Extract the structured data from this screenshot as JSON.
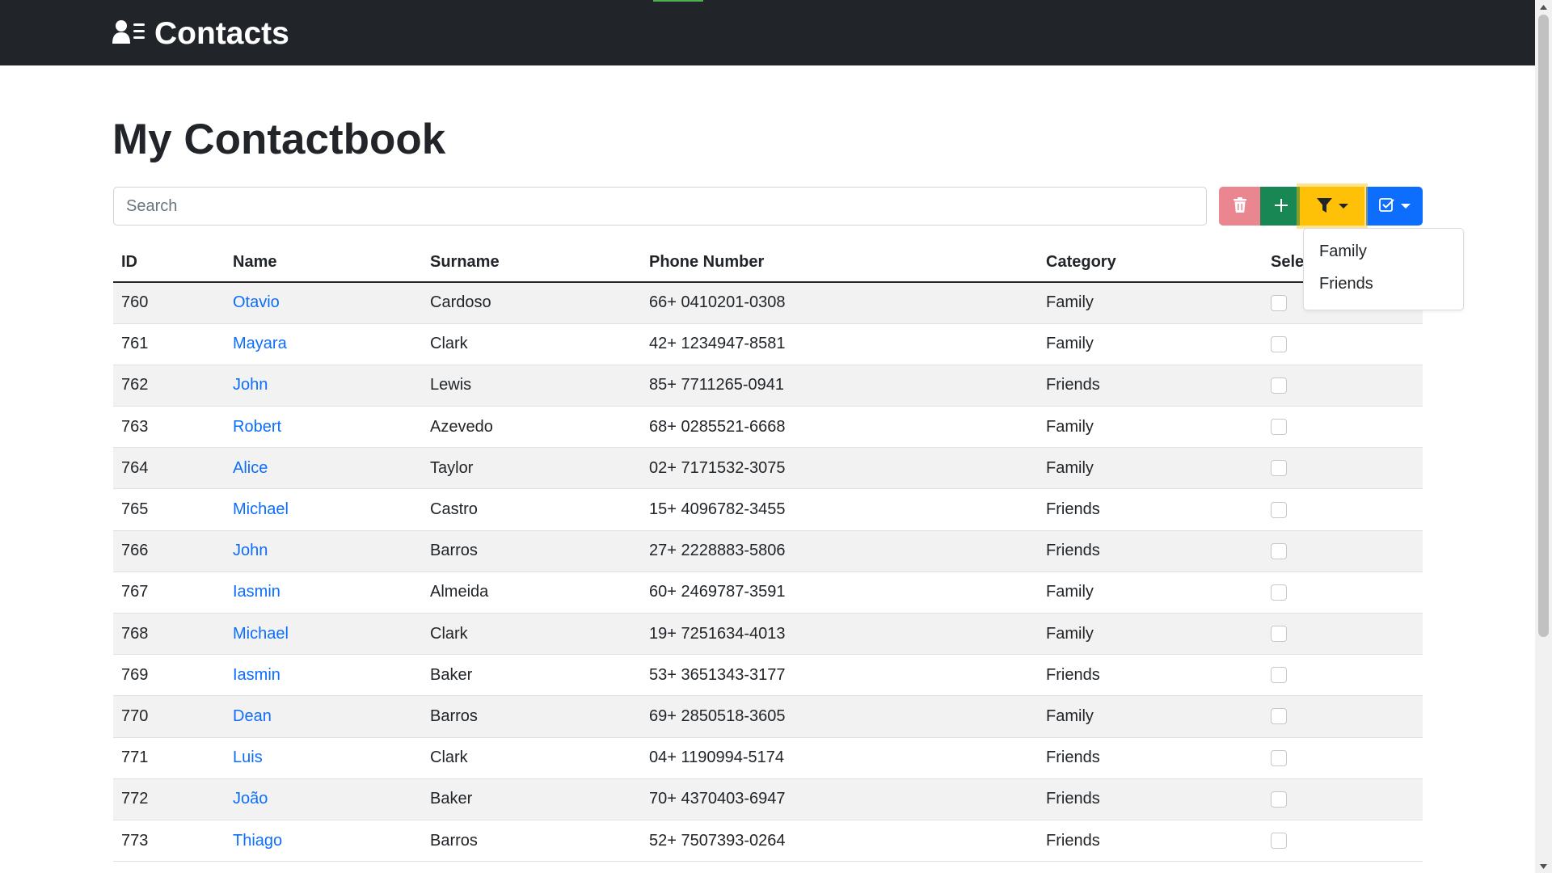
{
  "navbar": {
    "brand": "Contacts",
    "brand_icon": "contacts-icon"
  },
  "page": {
    "title": "My Contactbook"
  },
  "search": {
    "placeholder": "Search",
    "value": ""
  },
  "toolbar": {
    "delete_icon": "trash-icon",
    "add_icon": "plus-icon",
    "filter_icon": "filter-icon",
    "select_icon": "check-square-icon",
    "colors": {
      "delete": "#ea868f",
      "add": "#198754",
      "filter": "#ffc107",
      "select": "#0d6efd"
    }
  },
  "filter_dropdown": {
    "items": [
      {
        "label": "Family"
      },
      {
        "label": "Friends"
      }
    ]
  },
  "table": {
    "headers": {
      "id": "ID",
      "name": "Name",
      "surname": "Surname",
      "phone": "Phone Number",
      "category": "Category",
      "select": "Sele"
    },
    "rows": [
      {
        "id": "760",
        "name": "Otavio",
        "surname": "Cardoso",
        "phone": "66+ 0410201-0308",
        "category": "Family",
        "selected": false
      },
      {
        "id": "761",
        "name": "Mayara",
        "surname": "Clark",
        "phone": "42+ 1234947-8581",
        "category": "Family",
        "selected": false
      },
      {
        "id": "762",
        "name": "John",
        "surname": "Lewis",
        "phone": "85+ 7711265-0941",
        "category": "Friends",
        "selected": false
      },
      {
        "id": "763",
        "name": "Robert",
        "surname": "Azevedo",
        "phone": "68+ 0285521-6668",
        "category": "Family",
        "selected": false
      },
      {
        "id": "764",
        "name": "Alice",
        "surname": "Taylor",
        "phone": "02+ 7171532-3075",
        "category": "Family",
        "selected": false
      },
      {
        "id": "765",
        "name": "Michael",
        "surname": "Castro",
        "phone": "15+ 4096782-3455",
        "category": "Friends",
        "selected": false
      },
      {
        "id": "766",
        "name": "John",
        "surname": "Barros",
        "phone": "27+ 2228883-5806",
        "category": "Friends",
        "selected": false
      },
      {
        "id": "767",
        "name": "Iasmin",
        "surname": "Almeida",
        "phone": "60+ 2469787-3591",
        "category": "Family",
        "selected": false
      },
      {
        "id": "768",
        "name": "Michael",
        "surname": "Clark",
        "phone": "19+ 7251634-4013",
        "category": "Family",
        "selected": false
      },
      {
        "id": "769",
        "name": "Iasmin",
        "surname": "Baker",
        "phone": "53+ 3651343-3177",
        "category": "Friends",
        "selected": false
      },
      {
        "id": "770",
        "name": "Dean",
        "surname": "Barros",
        "phone": "69+ 2850518-3605",
        "category": "Family",
        "selected": false
      },
      {
        "id": "771",
        "name": "Luis",
        "surname": "Clark",
        "phone": "04+ 1190994-5174",
        "category": "Friends",
        "selected": false
      },
      {
        "id": "772",
        "name": "João",
        "surname": "Baker",
        "phone": "70+ 4370403-6947",
        "category": "Friends",
        "selected": false
      },
      {
        "id": "773",
        "name": "Thiago",
        "surname": "Barros",
        "phone": "52+ 7507393-0264",
        "category": "Friends",
        "selected": false
      }
    ]
  }
}
